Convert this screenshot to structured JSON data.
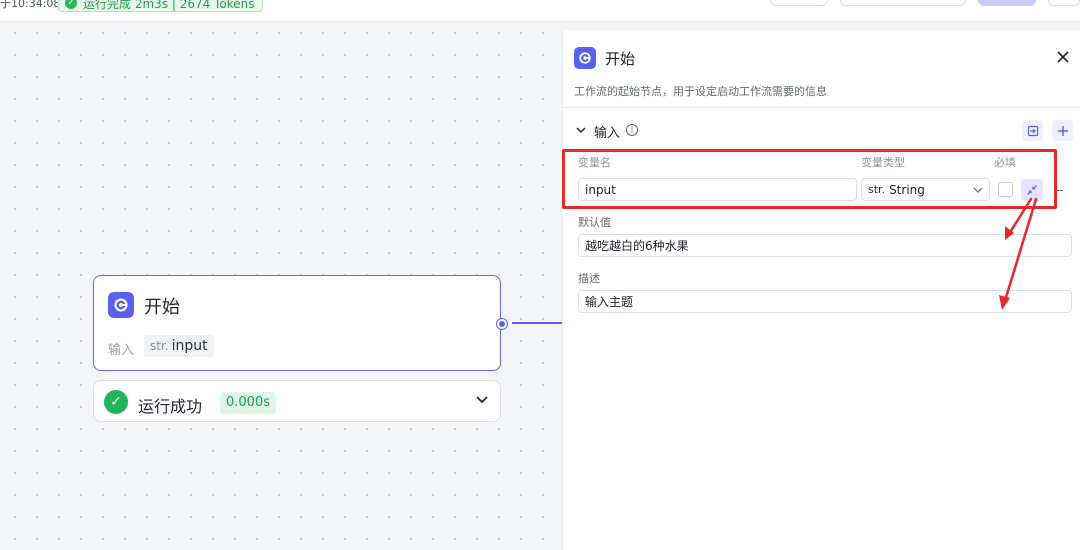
{
  "topbar": {
    "time_text": "于10:34:08",
    "run_status": "运行完成 2m3s | 2674 Tokens"
  },
  "node": {
    "title": "开始",
    "input_label": "输入",
    "var_type": "str.",
    "var_name": "input"
  },
  "result": {
    "status": "运行成功",
    "time": "0.000s"
  },
  "panel": {
    "title": "开始",
    "description": "工作流的起始节点，用于设定启动工作流需要的信息",
    "section_title": "输入",
    "columns": {
      "name": "变量名",
      "type": "变量类型",
      "required": "必填"
    },
    "variable": {
      "name": "input",
      "type_prefix": "str.",
      "type": "String",
      "required": false
    },
    "default_label": "默认值",
    "default_value": "越吃越白的6种水果",
    "desc_label": "描述",
    "desc_value": "输入主题"
  },
  "colors": {
    "accent": "#5b5ff2",
    "success": "#22b45a",
    "annotation": "#e52a2a"
  }
}
